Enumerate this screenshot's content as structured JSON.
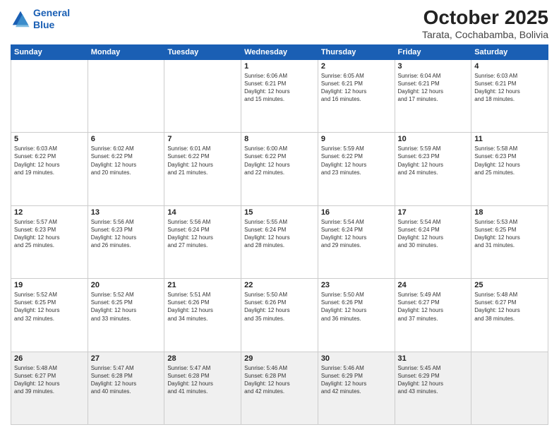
{
  "header": {
    "logo_line1": "General",
    "logo_line2": "Blue",
    "month": "October 2025",
    "location": "Tarata, Cochabamba, Bolivia"
  },
  "weekdays": [
    "Sunday",
    "Monday",
    "Tuesday",
    "Wednesday",
    "Thursday",
    "Friday",
    "Saturday"
  ],
  "weeks": [
    [
      {
        "day": "",
        "info": ""
      },
      {
        "day": "",
        "info": ""
      },
      {
        "day": "",
        "info": ""
      },
      {
        "day": "1",
        "info": "Sunrise: 6:06 AM\nSunset: 6:21 PM\nDaylight: 12 hours\nand 15 minutes."
      },
      {
        "day": "2",
        "info": "Sunrise: 6:05 AM\nSunset: 6:21 PM\nDaylight: 12 hours\nand 16 minutes."
      },
      {
        "day": "3",
        "info": "Sunrise: 6:04 AM\nSunset: 6:21 PM\nDaylight: 12 hours\nand 17 minutes."
      },
      {
        "day": "4",
        "info": "Sunrise: 6:03 AM\nSunset: 6:21 PM\nDaylight: 12 hours\nand 18 minutes."
      }
    ],
    [
      {
        "day": "5",
        "info": "Sunrise: 6:03 AM\nSunset: 6:22 PM\nDaylight: 12 hours\nand 19 minutes."
      },
      {
        "day": "6",
        "info": "Sunrise: 6:02 AM\nSunset: 6:22 PM\nDaylight: 12 hours\nand 20 minutes."
      },
      {
        "day": "7",
        "info": "Sunrise: 6:01 AM\nSunset: 6:22 PM\nDaylight: 12 hours\nand 21 minutes."
      },
      {
        "day": "8",
        "info": "Sunrise: 6:00 AM\nSunset: 6:22 PM\nDaylight: 12 hours\nand 22 minutes."
      },
      {
        "day": "9",
        "info": "Sunrise: 5:59 AM\nSunset: 6:22 PM\nDaylight: 12 hours\nand 23 minutes."
      },
      {
        "day": "10",
        "info": "Sunrise: 5:59 AM\nSunset: 6:23 PM\nDaylight: 12 hours\nand 24 minutes."
      },
      {
        "day": "11",
        "info": "Sunrise: 5:58 AM\nSunset: 6:23 PM\nDaylight: 12 hours\nand 25 minutes."
      }
    ],
    [
      {
        "day": "12",
        "info": "Sunrise: 5:57 AM\nSunset: 6:23 PM\nDaylight: 12 hours\nand 25 minutes."
      },
      {
        "day": "13",
        "info": "Sunrise: 5:56 AM\nSunset: 6:23 PM\nDaylight: 12 hours\nand 26 minutes."
      },
      {
        "day": "14",
        "info": "Sunrise: 5:56 AM\nSunset: 6:24 PM\nDaylight: 12 hours\nand 27 minutes."
      },
      {
        "day": "15",
        "info": "Sunrise: 5:55 AM\nSunset: 6:24 PM\nDaylight: 12 hours\nand 28 minutes."
      },
      {
        "day": "16",
        "info": "Sunrise: 5:54 AM\nSunset: 6:24 PM\nDaylight: 12 hours\nand 29 minutes."
      },
      {
        "day": "17",
        "info": "Sunrise: 5:54 AM\nSunset: 6:24 PM\nDaylight: 12 hours\nand 30 minutes."
      },
      {
        "day": "18",
        "info": "Sunrise: 5:53 AM\nSunset: 6:25 PM\nDaylight: 12 hours\nand 31 minutes."
      }
    ],
    [
      {
        "day": "19",
        "info": "Sunrise: 5:52 AM\nSunset: 6:25 PM\nDaylight: 12 hours\nand 32 minutes."
      },
      {
        "day": "20",
        "info": "Sunrise: 5:52 AM\nSunset: 6:25 PM\nDaylight: 12 hours\nand 33 minutes."
      },
      {
        "day": "21",
        "info": "Sunrise: 5:51 AM\nSunset: 6:26 PM\nDaylight: 12 hours\nand 34 minutes."
      },
      {
        "day": "22",
        "info": "Sunrise: 5:50 AM\nSunset: 6:26 PM\nDaylight: 12 hours\nand 35 minutes."
      },
      {
        "day": "23",
        "info": "Sunrise: 5:50 AM\nSunset: 6:26 PM\nDaylight: 12 hours\nand 36 minutes."
      },
      {
        "day": "24",
        "info": "Sunrise: 5:49 AM\nSunset: 6:27 PM\nDaylight: 12 hours\nand 37 minutes."
      },
      {
        "day": "25",
        "info": "Sunrise: 5:48 AM\nSunset: 6:27 PM\nDaylight: 12 hours\nand 38 minutes."
      }
    ],
    [
      {
        "day": "26",
        "info": "Sunrise: 5:48 AM\nSunset: 6:27 PM\nDaylight: 12 hours\nand 39 minutes."
      },
      {
        "day": "27",
        "info": "Sunrise: 5:47 AM\nSunset: 6:28 PM\nDaylight: 12 hours\nand 40 minutes."
      },
      {
        "day": "28",
        "info": "Sunrise: 5:47 AM\nSunset: 6:28 PM\nDaylight: 12 hours\nand 41 minutes."
      },
      {
        "day": "29",
        "info": "Sunrise: 5:46 AM\nSunset: 6:28 PM\nDaylight: 12 hours\nand 42 minutes."
      },
      {
        "day": "30",
        "info": "Sunrise: 5:46 AM\nSunset: 6:29 PM\nDaylight: 12 hours\nand 42 minutes."
      },
      {
        "day": "31",
        "info": "Sunrise: 5:45 AM\nSunset: 6:29 PM\nDaylight: 12 hours\nand 43 minutes."
      },
      {
        "day": "",
        "info": ""
      }
    ]
  ]
}
